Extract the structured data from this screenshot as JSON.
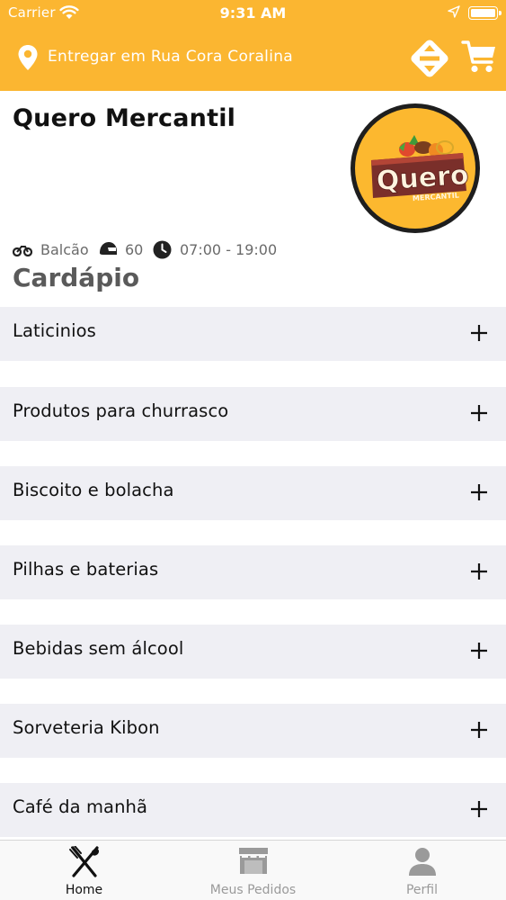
{
  "status_bar": {
    "carrier": "Carrier",
    "time": "9:31 AM"
  },
  "header": {
    "address": "Entregar em Rua Cora Coralina",
    "background_color": "#fbb631"
  },
  "store": {
    "name": "Quero Mercantil",
    "logo_text": "Quero",
    "logo_subtext": "MERCANTIL",
    "delivery_mode": "Balcão",
    "delivery_time": "60",
    "hours": "07:00 - 19:00"
  },
  "menu": {
    "title": "Cardápio",
    "categories": [
      {
        "label": "Laticinios",
        "icon": "plus-icon"
      },
      {
        "label": "Produtos para churrasco",
        "icon": "plus-icon"
      },
      {
        "label": "Biscoito e bolacha",
        "icon": "plus-icon"
      },
      {
        "label": "Pilhas e baterias",
        "icon": "plus-icon"
      },
      {
        "label": "Bebidas sem álcool",
        "icon": "plus-icon"
      },
      {
        "label": "Sorveteria Kibon",
        "icon": "plus-icon"
      },
      {
        "label": "Café da manhã",
        "icon": "plus-icon"
      }
    ]
  },
  "tabbar": {
    "tabs": [
      {
        "label": "Home",
        "icon": "fork-knife-icon",
        "active": true
      },
      {
        "label": "Meus Pedidos",
        "icon": "store-icon",
        "active": false
      },
      {
        "label": "Perfil",
        "icon": "person-icon",
        "active": false
      }
    ],
    "active_color": "#111111",
    "inactive_color": "#9a9a9a"
  }
}
